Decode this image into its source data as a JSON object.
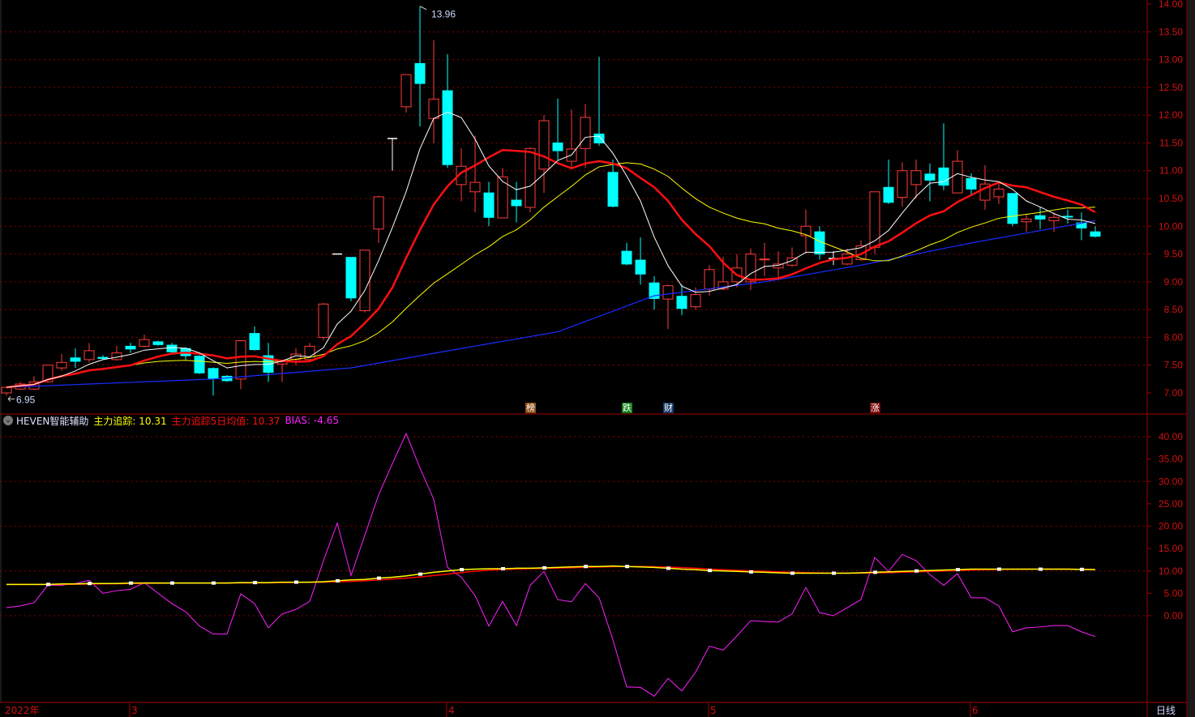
{
  "colors": {
    "up": "#ff3b3b",
    "down": "#00ffff",
    "ma5": "#ffffff",
    "ma10": "#ff1010",
    "ma20": "#ffff00",
    "ma60": "#1a2cff",
    "axis": "#a00000",
    "axis_text": "#d01010",
    "bias": "#ff20ff",
    "track": "#ffff00",
    "track_avg": "#ff0000"
  },
  "indicator": {
    "name": "HEVEN智能辅助",
    "track_label": "主力追踪: 10.31",
    "track_avg_label": "主力追踪5日均值: 10.37",
    "bias_label": "BIAS: -4.65"
  },
  "period_label": "日线",
  "signals": [
    {
      "index": 38,
      "text": "榜",
      "color": "#8b4a12"
    },
    {
      "index": 45,
      "text": "跌",
      "color": "#12801a"
    },
    {
      "index": 48,
      "text": "财",
      "color": "#153a6a"
    },
    {
      "index": 63,
      "text": "涨",
      "color": "#7a0a0a"
    }
  ],
  "chart_data": [
    {
      "type": "candlestick",
      "title": "price",
      "ylim": [
        6.8,
        14.05
      ],
      "y_ticks": [
        "14.00",
        "13.50",
        "13.00",
        "12.50",
        "12.00",
        "11.50",
        "11.00",
        "10.50",
        "10.00",
        "9.50",
        "9.00",
        "8.50",
        "8.00",
        "7.50",
        "7.00"
      ],
      "x_ticks": [
        {
          "index": 0,
          "label": "2022年"
        },
        {
          "index": 9,
          "label": "3"
        },
        {
          "index": 32,
          "label": "4"
        },
        {
          "index": 51,
          "label": "5"
        },
        {
          "index": 70,
          "label": "6"
        }
      ],
      "annotations": {
        "high": {
          "index": 30,
          "label": "13.96"
        },
        "low": {
          "index": 0,
          "label": "6.95"
        }
      },
      "ohlc_note": "[open, close, high, low]",
      "candles": [
        [
          7.0,
          7.1,
          7.12,
          6.95
        ],
        [
          7.07,
          7.16,
          7.2,
          7.05
        ],
        [
          7.07,
          7.2,
          7.3,
          7.05
        ],
        [
          7.2,
          7.5,
          7.5,
          7.18
        ],
        [
          7.45,
          7.55,
          7.7,
          7.4
        ],
        [
          7.63,
          7.57,
          7.8,
          7.45
        ],
        [
          7.6,
          7.76,
          7.9,
          7.55
        ],
        [
          7.64,
          7.62,
          7.68,
          7.6
        ],
        [
          7.6,
          7.72,
          7.85,
          7.58
        ],
        [
          7.84,
          7.79,
          7.9,
          7.72
        ],
        [
          7.84,
          7.96,
          8.05,
          7.82
        ],
        [
          7.92,
          7.87,
          7.94,
          7.85
        ],
        [
          7.86,
          7.74,
          7.9,
          7.72
        ],
        [
          7.8,
          7.67,
          7.82,
          7.6
        ],
        [
          7.66,
          7.36,
          7.68,
          7.34
        ],
        [
          7.44,
          7.26,
          7.46,
          6.95
        ],
        [
          7.3,
          7.22,
          7.32,
          7.2
        ],
        [
          7.25,
          7.94,
          7.95,
          7.07
        ],
        [
          8.07,
          7.78,
          8.2,
          7.76
        ],
        [
          7.67,
          7.37,
          7.9,
          7.2
        ],
        [
          7.52,
          7.56,
          7.6,
          7.2
        ],
        [
          7.6,
          7.7,
          7.8,
          7.5
        ],
        [
          7.6,
          7.84,
          7.9,
          7.55
        ],
        [
          8.0,
          8.6,
          8.62,
          7.95
        ],
        [
          9.5,
          9.5,
          9.5,
          9.5
        ],
        [
          9.44,
          8.71,
          9.44,
          8.65
        ],
        [
          8.48,
          9.57,
          9.57,
          8.45
        ],
        [
          9.95,
          10.53,
          10.55,
          9.7
        ],
        [
          11.58,
          11.58,
          11.58,
          11.0
        ],
        [
          12.15,
          12.73,
          12.73,
          12.05
        ],
        [
          12.93,
          12.57,
          13.96,
          11.8
        ],
        [
          11.94,
          12.29,
          13.35,
          11.5
        ],
        [
          12.44,
          11.11,
          13.1,
          11.05
        ],
        [
          10.75,
          11.08,
          11.4,
          10.45
        ],
        [
          10.62,
          10.79,
          11.63,
          10.25
        ],
        [
          10.6,
          10.16,
          10.8,
          10.0
        ],
        [
          10.15,
          10.89,
          11.05,
          10.15
        ],
        [
          10.47,
          10.37,
          10.8,
          10.07
        ],
        [
          10.34,
          11.4,
          11.42,
          10.25
        ],
        [
          11.03,
          11.9,
          12.0,
          10.6
        ],
        [
          11.5,
          11.36,
          12.3,
          11.2
        ],
        [
          11.17,
          11.39,
          12.1,
          11.05
        ],
        [
          11.4,
          11.96,
          12.2,
          11.05
        ],
        [
          11.66,
          11.5,
          13.05,
          11.45
        ],
        [
          10.97,
          10.36,
          11.2,
          10.34
        ],
        [
          9.55,
          9.32,
          9.7,
          9.3
        ],
        [
          9.39,
          9.14,
          9.8,
          8.95
        ],
        [
          8.98,
          8.7,
          9.1,
          8.5
        ],
        [
          8.69,
          8.93,
          8.95,
          8.15
        ],
        [
          8.74,
          8.52,
          8.95,
          8.4
        ],
        [
          8.55,
          8.77,
          8.9,
          8.5
        ],
        [
          8.87,
          9.22,
          9.3,
          8.75
        ],
        [
          8.87,
          9.0,
          9.45,
          8.85
        ],
        [
          9.0,
          9.25,
          9.5,
          8.9
        ],
        [
          9.0,
          9.5,
          9.6,
          8.85
        ],
        [
          9.4,
          9.41,
          9.7,
          9.1
        ],
        [
          9.25,
          9.32,
          9.55,
          9.05
        ],
        [
          9.3,
          9.43,
          9.62,
          9.27
        ],
        [
          9.83,
          10.0,
          10.3,
          9.5
        ],
        [
          9.9,
          9.5,
          10.0,
          9.4
        ],
        [
          9.42,
          9.42,
          9.55,
          9.3
        ],
        [
          9.32,
          9.5,
          9.6,
          9.3
        ],
        [
          9.4,
          9.65,
          9.75,
          9.38
        ],
        [
          9.62,
          10.62,
          10.62,
          9.5
        ],
        [
          10.7,
          10.43,
          11.2,
          10.4
        ],
        [
          10.52,
          11.0,
          11.15,
          10.35
        ],
        [
          10.75,
          11.0,
          11.2,
          10.5
        ],
        [
          10.94,
          10.83,
          11.13,
          10.45
        ],
        [
          11.05,
          10.74,
          11.85,
          10.65
        ],
        [
          10.6,
          11.17,
          11.37,
          10.6
        ],
        [
          10.86,
          10.67,
          10.95,
          10.55
        ],
        [
          10.47,
          10.76,
          11.1,
          10.3
        ],
        [
          10.53,
          10.67,
          10.8,
          10.4
        ],
        [
          10.59,
          10.05,
          10.6,
          10.0
        ],
        [
          10.08,
          10.13,
          10.22,
          9.9
        ],
        [
          10.19,
          10.13,
          10.35,
          9.95
        ],
        [
          10.1,
          10.16,
          10.25,
          9.9
        ],
        [
          10.18,
          10.17,
          10.3,
          10.05
        ],
        [
          10.06,
          9.97,
          10.25,
          9.75
        ],
        [
          9.9,
          9.82,
          10.0,
          9.8
        ]
      ],
      "ma60_keypoints": [
        [
          0,
          7.1
        ],
        [
          15,
          7.25
        ],
        [
          25,
          7.45
        ],
        [
          33,
          7.8
        ],
        [
          40,
          8.1
        ],
        [
          47,
          8.75
        ],
        [
          55,
          9.0
        ],
        [
          62,
          9.3
        ],
        [
          70,
          9.7
        ],
        [
          79,
          10.1
        ]
      ]
    },
    {
      "type": "line",
      "title": "HEVEN智能辅助",
      "ylim": [
        -18,
        42
      ],
      "y_ticks": [
        "40.00",
        "35.00",
        "30.00",
        "25.00",
        "20.00",
        "15.00",
        "10.00",
        "5.00",
        "0.00"
      ],
      "series": [
        {
          "name": "主力追踪",
          "values": [
            7.0,
            7.0,
            7.0,
            7.0,
            7.1,
            7.1,
            7.2,
            7.2,
            7.2,
            7.3,
            7.3,
            7.3,
            7.3,
            7.3,
            7.3,
            7.3,
            7.3,
            7.4,
            7.4,
            7.4,
            7.5,
            7.5,
            7.5,
            7.6,
            7.8,
            8.0,
            8.1,
            8.4,
            8.6,
            8.9,
            9.3,
            9.7,
            10.0,
            10.3,
            10.4,
            10.5,
            10.5,
            10.6,
            10.6,
            10.7,
            10.8,
            10.9,
            11.0,
            11.0,
            11.1,
            11.0,
            10.9,
            10.8,
            10.6,
            10.4,
            10.3,
            10.1,
            10.0,
            9.9,
            9.8,
            9.7,
            9.6,
            9.5,
            9.5,
            9.5,
            9.5,
            9.5,
            9.6,
            9.7,
            9.8,
            9.9,
            10.0,
            10.1,
            10.2,
            10.3,
            10.4,
            10.4,
            10.4,
            10.4,
            10.4,
            10.4,
            10.4,
            10.4,
            10.35,
            10.31
          ]
        },
        {
          "name": "BIAS",
          "values": [
            1.8,
            2.2,
            2.9,
            6.8,
            6.8,
            7.2,
            7.9,
            5,
            5.6,
            5.9,
            7.4,
            5,
            2.7,
            0.9,
            -2.3,
            -4.1,
            -4.1,
            4.9,
            2.7,
            -2.7,
            0.4,
            1.4,
            3.2,
            12.3,
            20.7,
            9,
            18,
            27,
            34,
            40.7,
            33,
            26,
            10.8,
            8.6,
            4.5,
            -2.3,
            3.2,
            -2.2,
            6.8,
            9.9,
            3.6,
            3.1,
            7.2,
            4,
            -5.4,
            -15.9,
            -16,
            -18,
            -14,
            -16.8,
            -12.6,
            -6.8,
            -7.7,
            -4.5,
            -1.1,
            -1.3,
            -1.4,
            0.4,
            6.3,
            0.7,
            0,
            1.8,
            3.6,
            13,
            9.9,
            13.7,
            12.3,
            9.2,
            6.8,
            9.4,
            4,
            4,
            2.2,
            -3.6,
            -2.7,
            -2.5,
            -2.2,
            -2.2,
            -3.6,
            -4.65
          ]
        }
      ]
    }
  ]
}
